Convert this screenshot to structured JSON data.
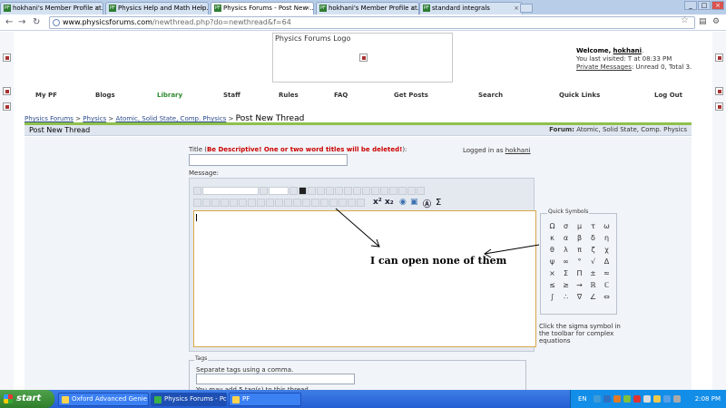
{
  "browser": {
    "tabs": [
      {
        "label": "hokhani's Member Profile at...",
        "active": false
      },
      {
        "label": "Physics Help and Math Help...",
        "active": false
      },
      {
        "label": "Physics Forums - Post New ...",
        "active": true
      },
      {
        "label": "hokhani's Member Profile at...",
        "active": false
      },
      {
        "label": "standard integrals",
        "active": false
      }
    ],
    "url_host": "www.physicsforums.com",
    "url_path": "/newthread.php?do=newthread&f=64"
  },
  "header": {
    "logo_text": "Physics Forums Logo",
    "welcome_prefix": "Welcome,",
    "username": "hokhani",
    "last_visited": "You last visited: T at 08:33 PM",
    "pm_link": "Private Messages",
    "pm_status": ": Unread 0, Total 3."
  },
  "nav": [
    "My PF",
    "Blogs",
    "Library",
    "Staff",
    "Rules",
    "FAQ",
    "Get Posts",
    "Search",
    "Quick Links",
    "Log Out"
  ],
  "breadcrumb": {
    "items": [
      "Physics Forums",
      "Physics",
      "Atomic, Solid State, Comp. Physics"
    ],
    "sep": ">",
    "current": "Post New Thread"
  },
  "panel": {
    "title": "Post New Thread",
    "forum_label": "Forum:",
    "forum_name": "Atomic, Solid State, Comp. Physics"
  },
  "form": {
    "title_label": "Title (",
    "title_warning": "Be Descriptive! One or two word titles will be deleted!",
    "title_label_end": "):",
    "title_value": "",
    "logged_in_prefix": "Logged in as",
    "logged_in_user": "hokhani",
    "message_label": "Message:",
    "message_value": ""
  },
  "quick_symbols": {
    "title": "Quick Symbols",
    "symbols": [
      "Ω",
      "σ",
      "μ",
      "τ",
      "ω",
      "κ",
      "α",
      "β",
      "δ",
      "η",
      "θ",
      "λ",
      "π",
      "ζ",
      "χ",
      "ψ",
      "∞",
      "°",
      "√",
      "Δ",
      "×",
      "Σ",
      "Π",
      "±",
      "≈",
      "≤",
      "≥",
      "→",
      "ℝ",
      "ℂ",
      "∫",
      "∴",
      "∇",
      "∠",
      "⇔"
    ],
    "help": "Click the sigma symbol in the toolbar for complex equations"
  },
  "annotation_text": "I can open none of them",
  "tags": {
    "title": "Tags",
    "hint": "Separate tags using a comma.",
    "value": "",
    "max_text": "You may add 5 tag(s) to this thread."
  },
  "taskbar": {
    "start_label": "start",
    "tasks": [
      "Oxford Advanced Genie",
      "Physics Forums - Post...",
      "PF"
    ],
    "lang": "EN",
    "clock": "2:08 PM"
  },
  "colors": {
    "accent_green": "#8fc04d",
    "warning_red": "#cc0000",
    "taskbar_blue": "#245ed3"
  }
}
